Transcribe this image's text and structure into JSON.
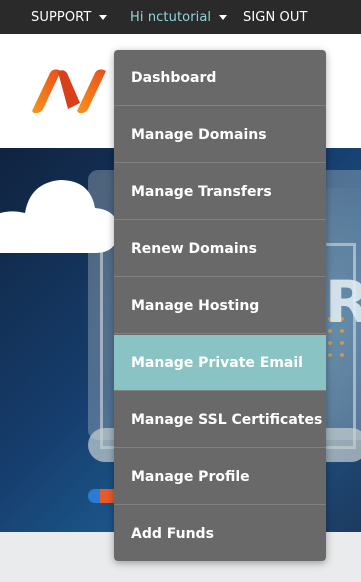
{
  "topbar": {
    "support_label": "SUPPORT",
    "user_greeting": "Hi nctutorial",
    "signout_label": "SIGN OUT"
  },
  "dropdown": {
    "items": [
      {
        "label": "Dashboard"
      },
      {
        "label": "Manage Domains"
      },
      {
        "label": "Manage Transfers"
      },
      {
        "label": "Renew Domains"
      },
      {
        "label": "Manage Hosting"
      },
      {
        "label": "Manage Private Email"
      },
      {
        "label": "Manage SSL Certificates"
      },
      {
        "label": "Manage Profile"
      },
      {
        "label": "Add Funds"
      }
    ],
    "active_item": "Manage Private Email"
  },
  "hero": {
    "partial_text": "RE"
  },
  "colors": {
    "topbar_bg": "#2a2a2a",
    "dropdown_bg": "#696969",
    "active_item_bg": "#89c3c3",
    "greeting_accent": "#8ed6db",
    "logo_orange": "#f05a1e"
  },
  "icons": {
    "logo": "namecheap-logo-icon",
    "support_caret": "chevron-down-icon",
    "user_caret": "chevron-down-icon",
    "cloud": "cloud-icon"
  }
}
